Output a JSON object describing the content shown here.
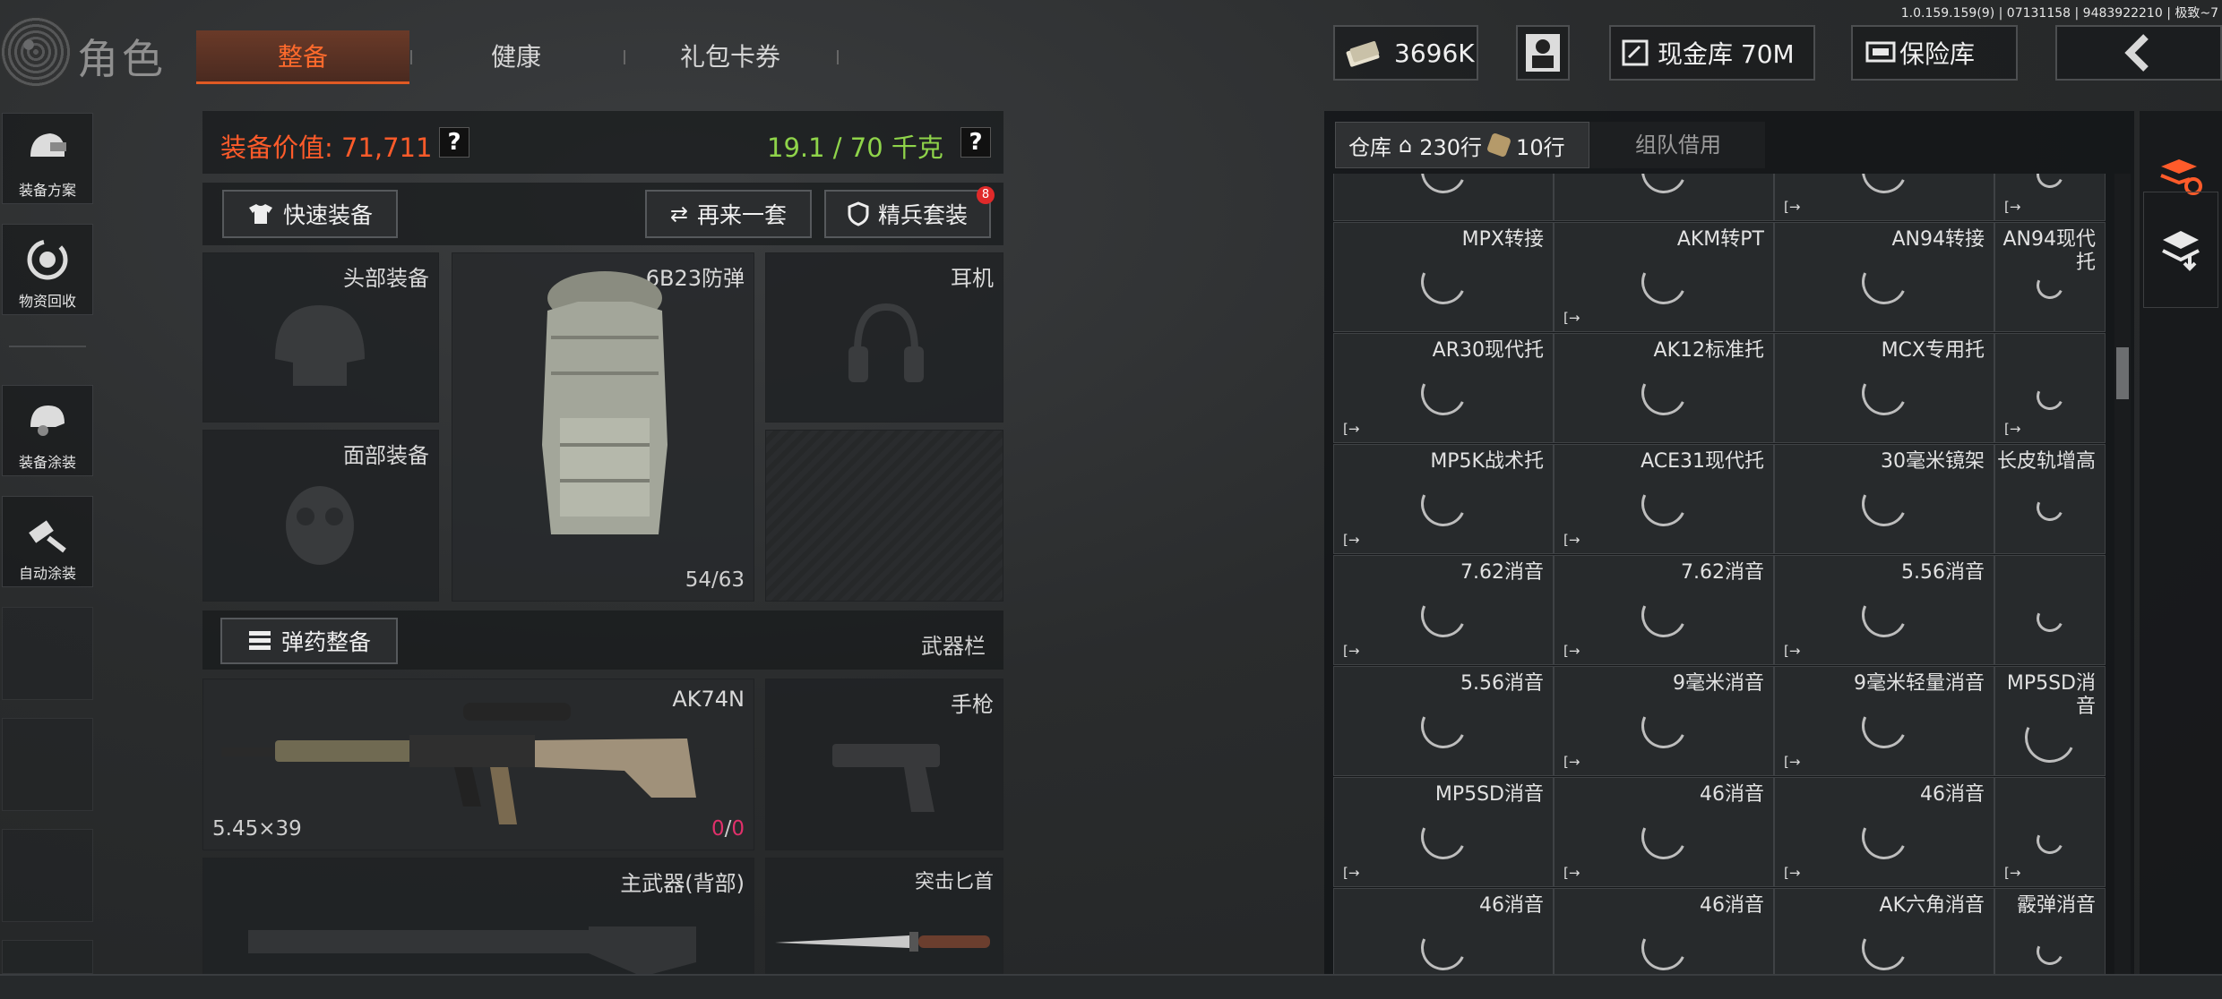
{
  "version": "1.0.159.159(9) | 07131158 | 9483922210 | 极致~7",
  "header": {
    "title": "角色",
    "tabs": [
      {
        "label": "整备",
        "active": true
      },
      {
        "label": "健康",
        "active": false
      },
      {
        "label": "礼包卡券",
        "active": false
      }
    ],
    "money": "3696K",
    "stash_label": "现金库 70M",
    "insurance_label": "保险库"
  },
  "sidebar": {
    "items": [
      {
        "label": "装备方案",
        "icon": "gear-preset-icon"
      },
      {
        "label": "物资回收",
        "icon": "recycle-icon"
      },
      {
        "label": "装备涂装",
        "icon": "helmet-paint-icon"
      },
      {
        "label": "自动涂装",
        "icon": "spray-brush-icon"
      }
    ]
  },
  "equipment": {
    "value_text": "装备价值: 71,711",
    "weight_text": "19.1 / 70 千克",
    "quick_equip": "快速装备",
    "retry_set": "再来一套",
    "elite_set": "精兵套装",
    "elite_badge": "8",
    "slots": {
      "head": "头部装备",
      "face": "面部装备",
      "armor": "6B23防弹",
      "armor_durability": "54/63",
      "earphone": "耳机"
    },
    "ammo_button": "弹药整备",
    "weapon_bar": "武器栏",
    "primary": {
      "name": "AK74N",
      "caliber": "5.45×39",
      "ammo_current": "0",
      "ammo_sep": "/",
      "ammo_max": "0"
    },
    "pistol": "手枪",
    "primary_back": "主武器(背部)",
    "knife": "突击匕首"
  },
  "warehouse": {
    "tab_warehouse": "仓库",
    "rows_home": "230行",
    "rows_bag": "10行",
    "tab_team": "组队借用",
    "cells": [
      [
        "",
        "",
        "",
        ""
      ],
      [
        "MPX转接",
        "AKM转PT",
        "AN94转接",
        "AN94现代托"
      ],
      [
        "AR30现代托",
        "AK12标准托",
        "MCX专用托",
        ""
      ],
      [
        "MP5K战术托",
        "ACE31现代托",
        "30毫米镜架",
        "长皮轨增高"
      ],
      [
        "7.62消音",
        "7.62消音",
        "5.56消音",
        ""
      ],
      [
        "5.56消音",
        "9毫米消音",
        "9毫米轻量消音",
        "MP5SD消音"
      ],
      [
        "MP5SD消音",
        "46消音",
        "46消音",
        ""
      ],
      [
        "46消音",
        "46消音",
        "AK六角消音",
        "霰弹消音"
      ]
    ]
  },
  "colors": {
    "accent": "#ff5b2a",
    "weight_green": "#8fd44a",
    "ammo_red": "#e0306a"
  }
}
